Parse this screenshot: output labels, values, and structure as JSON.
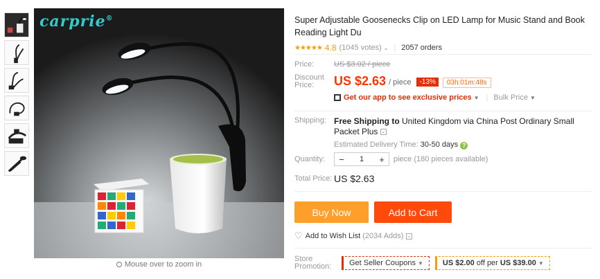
{
  "product": {
    "title": "Super Adjustable Goosenecks Clip on LED Lamp for Music Stand and Book Reading Light Du",
    "brand_logo": "carprie",
    "brand_mark": "®",
    "zoom_hint": "Mouse over to zoom in",
    "thumbnails": [
      "thumb-1",
      "thumb-2",
      "thumb-3",
      "thumb-4",
      "thumb-5",
      "thumb-6"
    ]
  },
  "rating": {
    "stars": "★★★★★",
    "value": "4.8",
    "votes": "(1045 votes)",
    "orders": "2057 orders"
  },
  "price": {
    "label": "Price:",
    "original": "US $3.02 / piece",
    "discount_label": "Discount Price:",
    "discount": "US $2.63",
    "per_piece": "/ piece",
    "off_badge": "-13%",
    "timer": "03h:01m:48s",
    "app_link": "Get our app to see exclusive prices",
    "bulk": "Bulk Price"
  },
  "shipping": {
    "label": "Shipping:",
    "method_prefix": "Free Shipping to",
    "method_rest": " United Kingdom via China Post Ordinary Small Packet Plus",
    "eta_label": "Estimated Delivery Time:",
    "eta_value": "30-50",
    "eta_unit": "days"
  },
  "quantity": {
    "label": "Quantity:",
    "minus": "−",
    "value": "1",
    "plus": "+",
    "note": "piece (180 pieces available)"
  },
  "total": {
    "label": "Total Price:",
    "value": "US $2.63"
  },
  "actions": {
    "buy_now": "Buy Now",
    "add_to_cart": "Add to Cart",
    "wishlist": "Add to Wish List",
    "wishlist_count": "(2034 Adds)"
  },
  "promotion": {
    "label": "Store Promotion:",
    "coupon": "Get Seller Coupons",
    "deal_amount": "US $2.00",
    "deal_mid": " off per ",
    "deal_threshold": "US $39.00"
  },
  "colors": {
    "accent_red": "#e62e04",
    "buy_orange": "#ff9f2b",
    "cart_orange": "#ff4a0c",
    "star": "#ff9900"
  }
}
